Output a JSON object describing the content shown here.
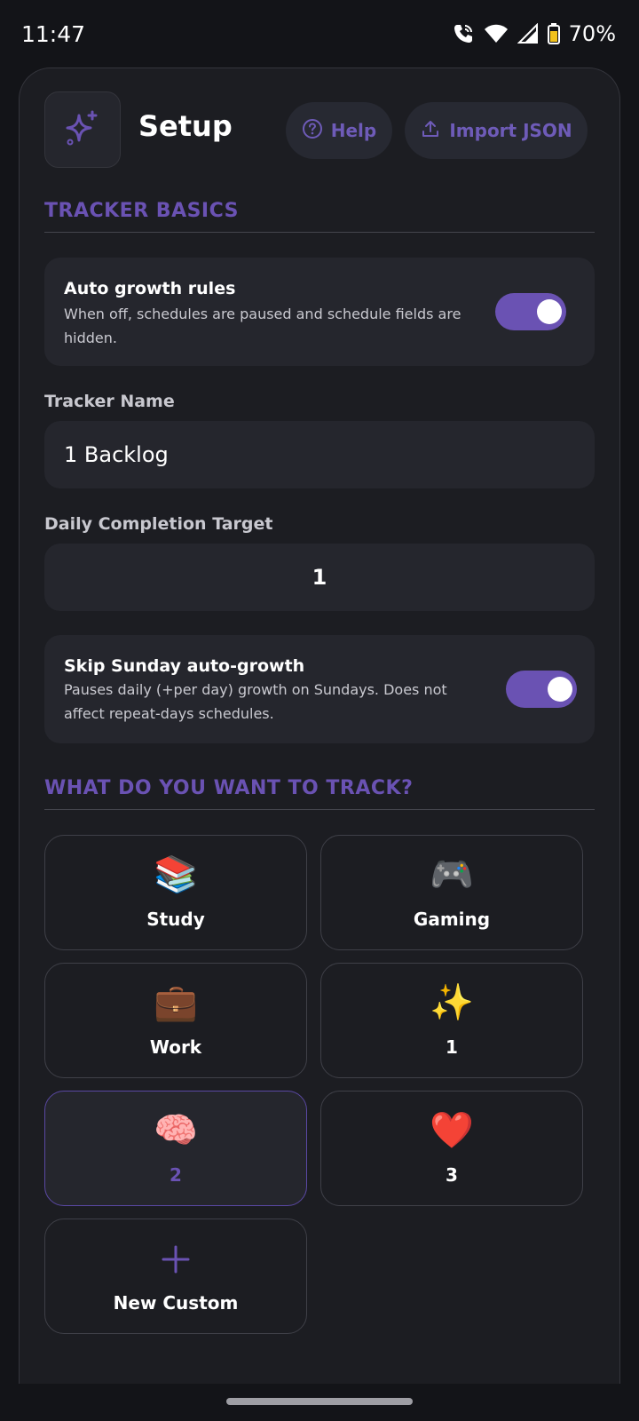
{
  "status_bar": {
    "time": "11:47",
    "battery": "70%",
    "icons": [
      "wifi-call-icon",
      "wifi-icon",
      "signal-icon",
      "battery-icon"
    ]
  },
  "header": {
    "title": "Setup",
    "help_label": "Help",
    "import_label": "Import JSON",
    "icons": [
      "sparkle-icon",
      "help-circle-icon",
      "upload-icon"
    ]
  },
  "sections": {
    "basics": "TRACKER BASICS",
    "track": "WHAT DO YOU WANT TO TRACK?"
  },
  "auto_growth": {
    "title": "Auto growth rules",
    "description": "When off, schedules are paused and schedule fields are hidden.",
    "enabled": true
  },
  "tracker_name": {
    "label": "Tracker Name",
    "value": "1 Backlog"
  },
  "daily_target": {
    "label": "Daily Completion Target",
    "value": "1"
  },
  "skip_sunday": {
    "title": "Skip Sunday auto-growth",
    "description": "Pauses daily (+per day) growth on Sundays. Does not affect repeat-days schedules.",
    "enabled": true
  },
  "categories": [
    {
      "emoji": "📚",
      "label": "Study",
      "icon": "books-icon",
      "selected": false
    },
    {
      "emoji": "🎮",
      "label": "Gaming",
      "icon": "gamepad-icon",
      "selected": false
    },
    {
      "emoji": "💼",
      "label": "Work",
      "icon": "briefcase-icon",
      "selected": false
    },
    {
      "emoji": "✨",
      "label": "1",
      "icon": "sparkles-icon",
      "selected": false
    },
    {
      "emoji": "🧠",
      "label": "2",
      "icon": "brain-icon",
      "selected": true
    },
    {
      "emoji": "❤️",
      "label": "3",
      "icon": "heart-icon",
      "selected": false
    },
    {
      "emoji": "+",
      "label": "New Custom",
      "icon": "plus-icon",
      "selected": false
    }
  ],
  "colors": {
    "accent": "#6a52b3",
    "background": "#131418",
    "card": "#1c1d22",
    "surface": "#25262d"
  }
}
